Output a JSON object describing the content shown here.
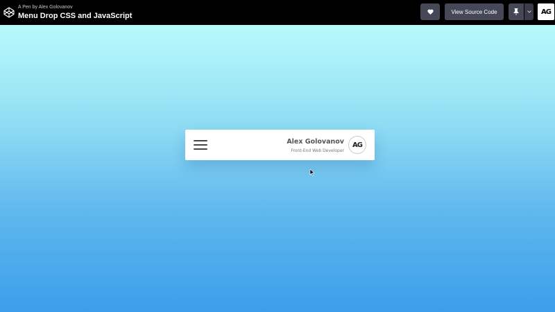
{
  "header": {
    "pen_by_prefix": "A Pen by",
    "author": "Alex Golovanov",
    "title": "Menu Drop CSS and JavaScript",
    "view_source_label": "View Source Code",
    "avatar_initials": "AG",
    "icons": [
      "codepen-logo-icon",
      "heart-icon",
      "pin-icon",
      "chevron-down-icon"
    ]
  },
  "card": {
    "name": "Alex Golovanov",
    "role": "Front-End Web Developer",
    "avatar_initials": "AG",
    "menu_icon": "hamburger-menu-icon"
  },
  "colors": {
    "topbar": "#000000",
    "button": "#444857",
    "gradient_top": "#b9fbfb",
    "gradient_bottom": "#3c9eea",
    "card": "#ffffff"
  }
}
